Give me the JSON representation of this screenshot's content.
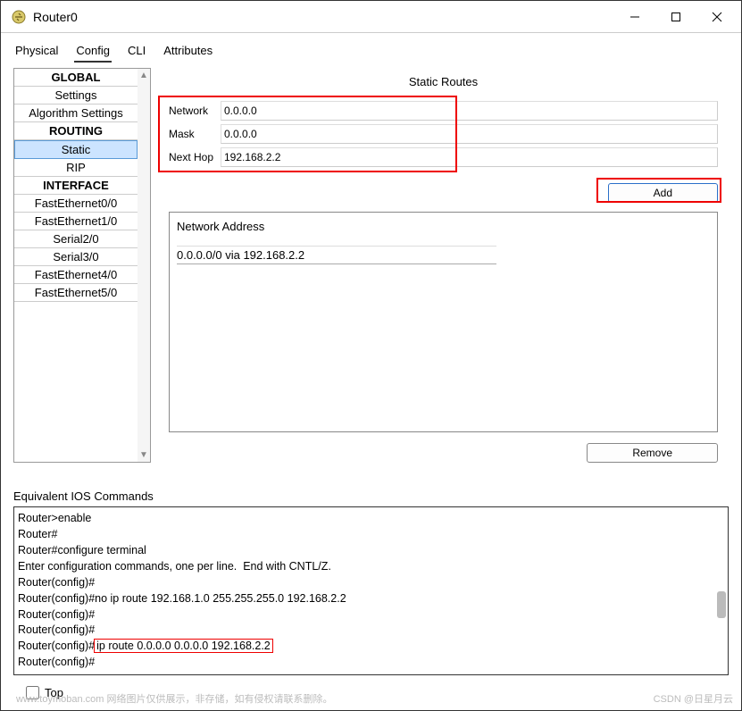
{
  "window": {
    "title": "Router0"
  },
  "tabs": {
    "physical": "Physical",
    "config": "Config",
    "cli": "CLI",
    "attributes": "Attributes"
  },
  "sidebar": {
    "global": "GLOBAL",
    "settings": "Settings",
    "algorithm": "Algorithm Settings",
    "routing": "ROUTING",
    "static": "Static",
    "rip": "RIP",
    "interface": "INTERFACE",
    "fe00": "FastEthernet0/0",
    "fe10": "FastEthernet1/0",
    "s20": "Serial2/0",
    "s30": "Serial3/0",
    "fe40": "FastEthernet4/0",
    "fe50": "FastEthernet5/0"
  },
  "form": {
    "title": "Static Routes",
    "network_label": "Network",
    "network_value": "0.0.0.0",
    "mask_label": "Mask",
    "mask_value": "0.0.0.0",
    "nexthop_label": "Next Hop",
    "nexthop_value": "192.168.2.2",
    "add": "Add",
    "remove": "Remove",
    "list_label": "Network Address",
    "list_entry": "0.0.0.0/0 via 192.168.2.2"
  },
  "ios": {
    "label": "Equivalent IOS Commands",
    "l1": "Router>enable",
    "l2": "Router#",
    "l3": "Router#configure terminal",
    "l4": "Enter configuration commands, one per line.  End with CNTL/Z.",
    "l5": "Router(config)#",
    "l6": "Router(config)#no ip route 192.168.1.0 255.255.255.0 192.168.2.2",
    "l7": "Router(config)#",
    "l8": "Router(config)#",
    "l9a": "Router(config)#",
    "l9b": "ip route 0.0.0.0 0.0.0.0 192.168.2.2",
    "l10": "Router(config)#"
  },
  "bottom": {
    "top": "Top"
  },
  "watermark": {
    "left": "www.toymoban.com  网络图片仅供展示，非存储，如有侵权请联系删除。",
    "right": "CSDN @日星月云"
  }
}
